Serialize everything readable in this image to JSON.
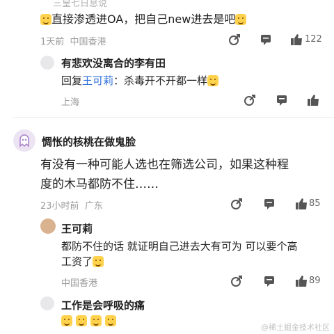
{
  "top_partial_text": "三皇七日息说",
  "comments": [
    {
      "text": "直接渗透进OA，把自己new进去是吧",
      "time": "1天前",
      "location": "中国香港",
      "likes": "122",
      "reply": {
        "name": "有悲欢没离合的李有田",
        "reply_prefix": "回复",
        "mention": "王可莉",
        "reply_text": "：杀毒开不开都一样",
        "location": "上海"
      }
    },
    {
      "name": "惆怅的核桃在做鬼脸",
      "text_line1": "有没有一种可能人选也在筛选公司，如果这种程",
      "text_line2": "度的木马都防不住……",
      "time": "23小时前",
      "location": "广东",
      "likes": "85",
      "reply": {
        "name": "王可莉",
        "text_line1": "都防不住的话 就证明自己进去大有可为 可以要个高",
        "text_line2": "工资了",
        "location": "中国香港",
        "likes": "89"
      }
    },
    {
      "name": "工作是会呼吸的痛"
    }
  ],
  "watermark": "@稀土掘金技术社区",
  "icons": {
    "share": "share-icon",
    "comment": "comment-icon",
    "like": "like-icon",
    "avatar_ghost": "ghost-avatar-icon"
  }
}
